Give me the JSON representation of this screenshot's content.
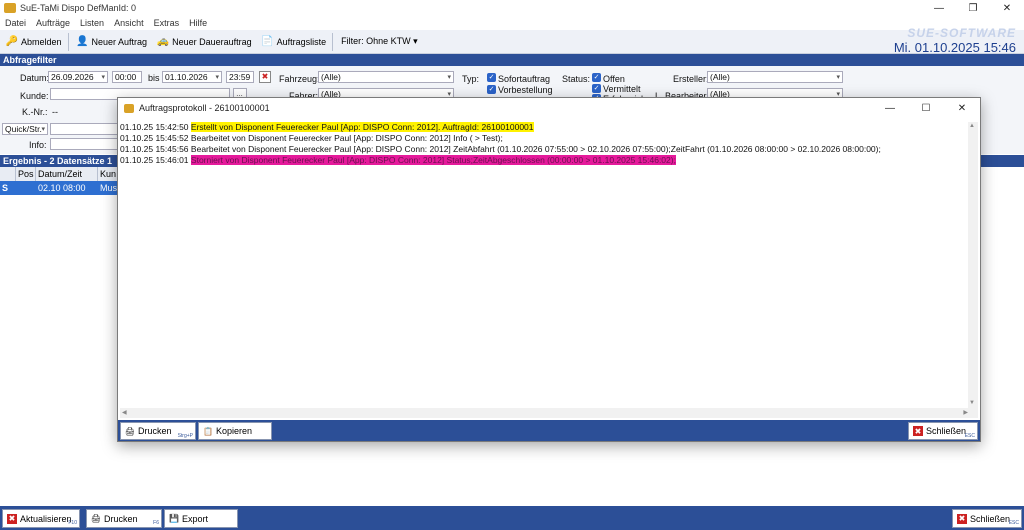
{
  "window": {
    "title": "SuE-TaMi Dispo  DefManId: 0"
  },
  "menu": [
    "Datei",
    "Aufträge",
    "Listen",
    "Ansicht",
    "Extras",
    "Hilfe"
  ],
  "toolbar": {
    "logout": "Abmelden",
    "new_order": "Neuer Auftrag",
    "new_standing_order": "Neuer Dauerauftrag",
    "order_list": "Auftragsliste",
    "filter": "Filter: Ohne KTW ▾"
  },
  "brand": {
    "logo": "SUE-SOFTWARE",
    "datetime": "Mi. 01.10.2025   15:46"
  },
  "query_filter": {
    "header": "Abfragefilter",
    "date_label": "Datum:",
    "date_from": "26.09.2026",
    "time_from": "00:00",
    "bis": "bis",
    "date_to": "01.10.2026",
    "time_to": "23:59",
    "vehicle_label": "Fahrzeug:",
    "vehicle_value": "(Alle)",
    "driver_label": "Fahrer:",
    "driver_value": "(Alle)",
    "customer_label": "Kunde:",
    "kno_label": "K.-Nr.:",
    "kno_value": "--",
    "quick_label": "Quick/Str.",
    "info_label": "Info:",
    "type_label": "Typ:",
    "type_options": [
      "Sofortauftrag",
      "Vorbestellung"
    ],
    "status_label": "Status:",
    "status_options": [
      "Offen",
      "Vermittelt",
      "Erfolgreich"
    ],
    "creator_label": "Ersteller:",
    "creator_value": "(Alle)",
    "editor_label": "L. Bearbeiter:",
    "editor_value": "(Alle)"
  },
  "result": {
    "header": "Ergebnis - 2 Datensätze 1",
    "columns": [
      "Pos",
      "Datum/Zeit",
      "Kun"
    ],
    "row": {
      "flag": "S",
      "datetime": "02.10 08:00",
      "customer": "Mus"
    }
  },
  "bottom": {
    "refresh": "Aktualisieren",
    "refresh_key": "F10",
    "print": "Drucken",
    "print_key": "F6",
    "export": "Export",
    "close": "Schließen",
    "close_key": "ESC"
  },
  "dialog": {
    "title": "Auftragsprotokoll - 26100100001",
    "log": [
      {
        "time": "01.10.25 15:42:50",
        "text": "Erstellt von Disponent Feuerecker Paul [App: DISPO Conn: 2012]. AuftragId: 26100100001",
        "hl": "yellow"
      },
      {
        "time": "01.10.25 15:45:52",
        "text": "Bearbeitet von Disponent Feuerecker Paul [App: DISPO Conn: 2012] Info ( > Test);",
        "hl": ""
      },
      {
        "time": "01.10.25 15:45:56",
        "text": "Bearbeitet von Disponent Feuerecker Paul [App: DISPO Conn: 2012] ZeitAbfahrt (01.10.2026 07:55:00 > 02.10.2026 07:55:00);ZeitFahrt (01.10.2026 08:00:00 > 02.10.2026 08:00:00);",
        "hl": ""
      },
      {
        "time": "01.10.25 15:46:01",
        "text": "Storniert von Disponent Feuerecker Paul [App: DISPO Conn: 2012] Status;ZeitAbgeschlossen (00:00:00 > 01.10.2025 15:46:02);",
        "hl": "pink"
      }
    ],
    "print": "Drucken",
    "print_key": "Strg+P",
    "copy": "Kopieren",
    "close": "Schließen",
    "close_key": "ESC"
  }
}
